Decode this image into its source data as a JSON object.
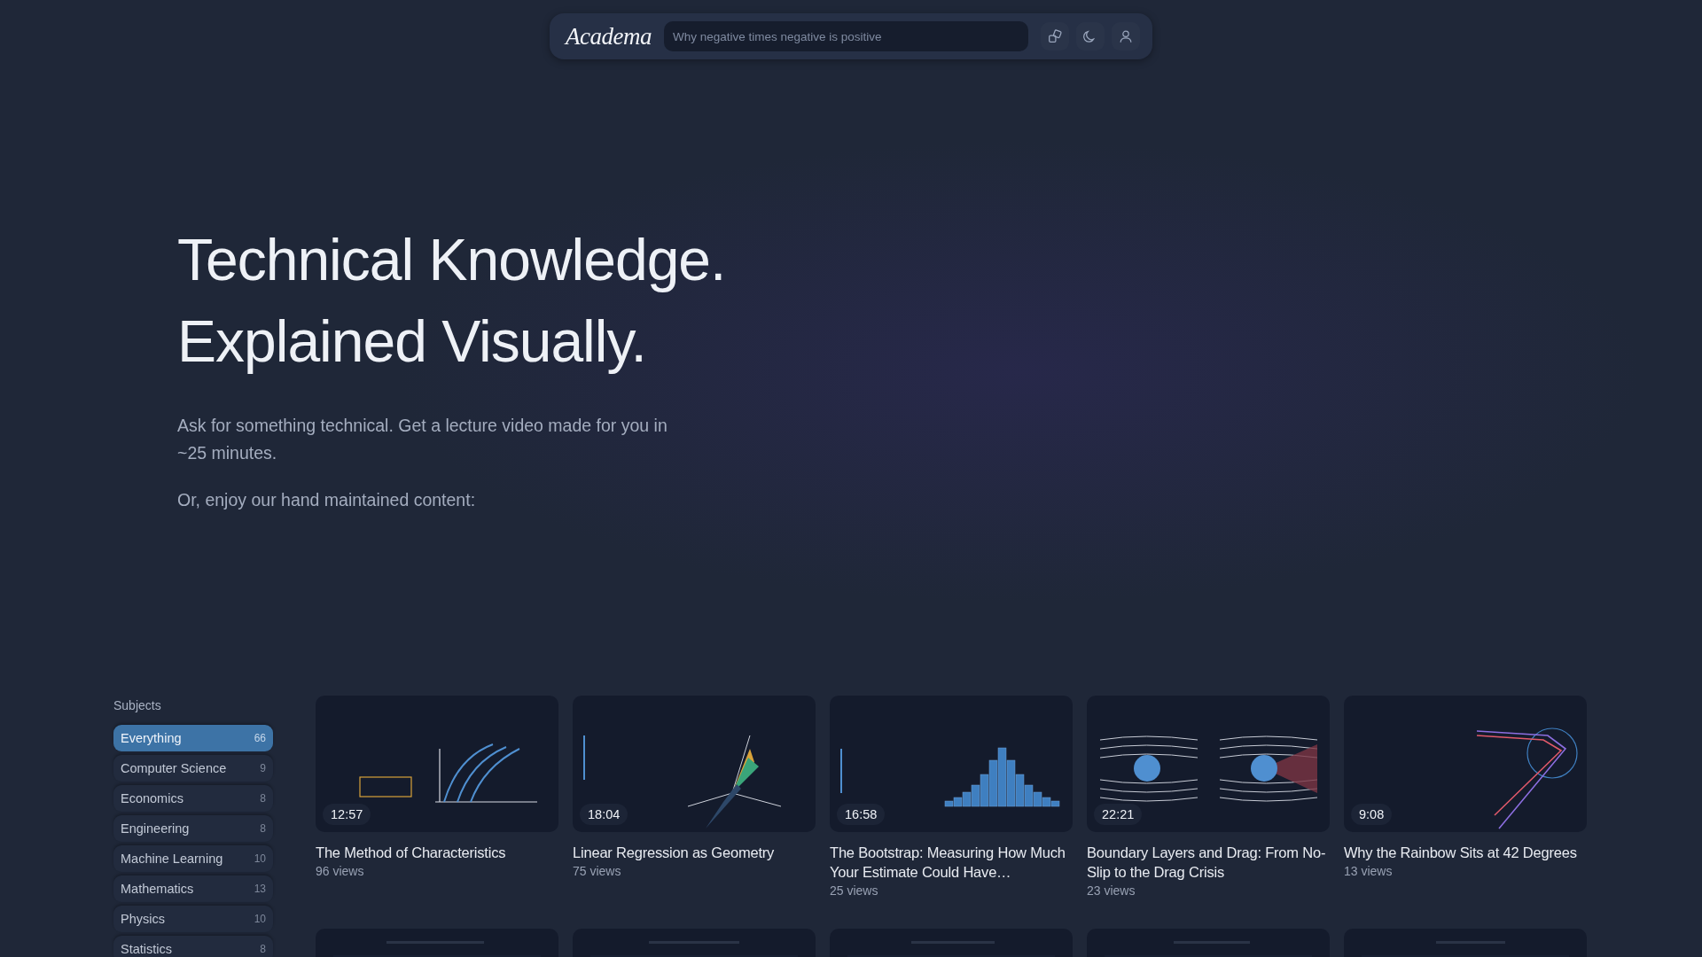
{
  "header": {
    "logo": "Academa",
    "search": {
      "placeholder": "Why negative times negative is positive"
    }
  },
  "hero": {
    "title_lines": [
      "Technical Knowledge.",
      "Explained Visually."
    ],
    "description": "Ask for something technical. Get a lecture video made for you in ~25 minutes.",
    "note": "Or, enjoy our hand maintained content:"
  },
  "subjects": {
    "heading": "Subjects",
    "items": [
      {
        "label": "Everything",
        "count": "66",
        "selected": true
      },
      {
        "label": "Computer Science",
        "count": "9",
        "selected": false
      },
      {
        "label": "Economics",
        "count": "8",
        "selected": false
      },
      {
        "label": "Engineering",
        "count": "8",
        "selected": false
      },
      {
        "label": "Machine Learning",
        "count": "10",
        "selected": false
      },
      {
        "label": "Mathematics",
        "count": "13",
        "selected": false
      },
      {
        "label": "Physics",
        "count": "10",
        "selected": false
      },
      {
        "label": "Statistics",
        "count": "8",
        "selected": false
      }
    ]
  },
  "videos": [
    {
      "duration": "12:57",
      "title": "The Method of Characteristics",
      "views": "96 views"
    },
    {
      "duration": "18:04",
      "title": "Linear Regression as Geometry",
      "views": "75 views"
    },
    {
      "duration": "16:58",
      "title": "The Bootstrap: Measuring How Much Your Estimate Could Have…",
      "views": "25 views"
    },
    {
      "duration": "22:21",
      "title": "Boundary Layers and Drag: From No-Slip to the Drag Crisis",
      "views": "23 views"
    },
    {
      "duration": "9:08",
      "title": "Why the Rainbow Sits at 42 Degrees",
      "views": "13 views"
    }
  ]
}
